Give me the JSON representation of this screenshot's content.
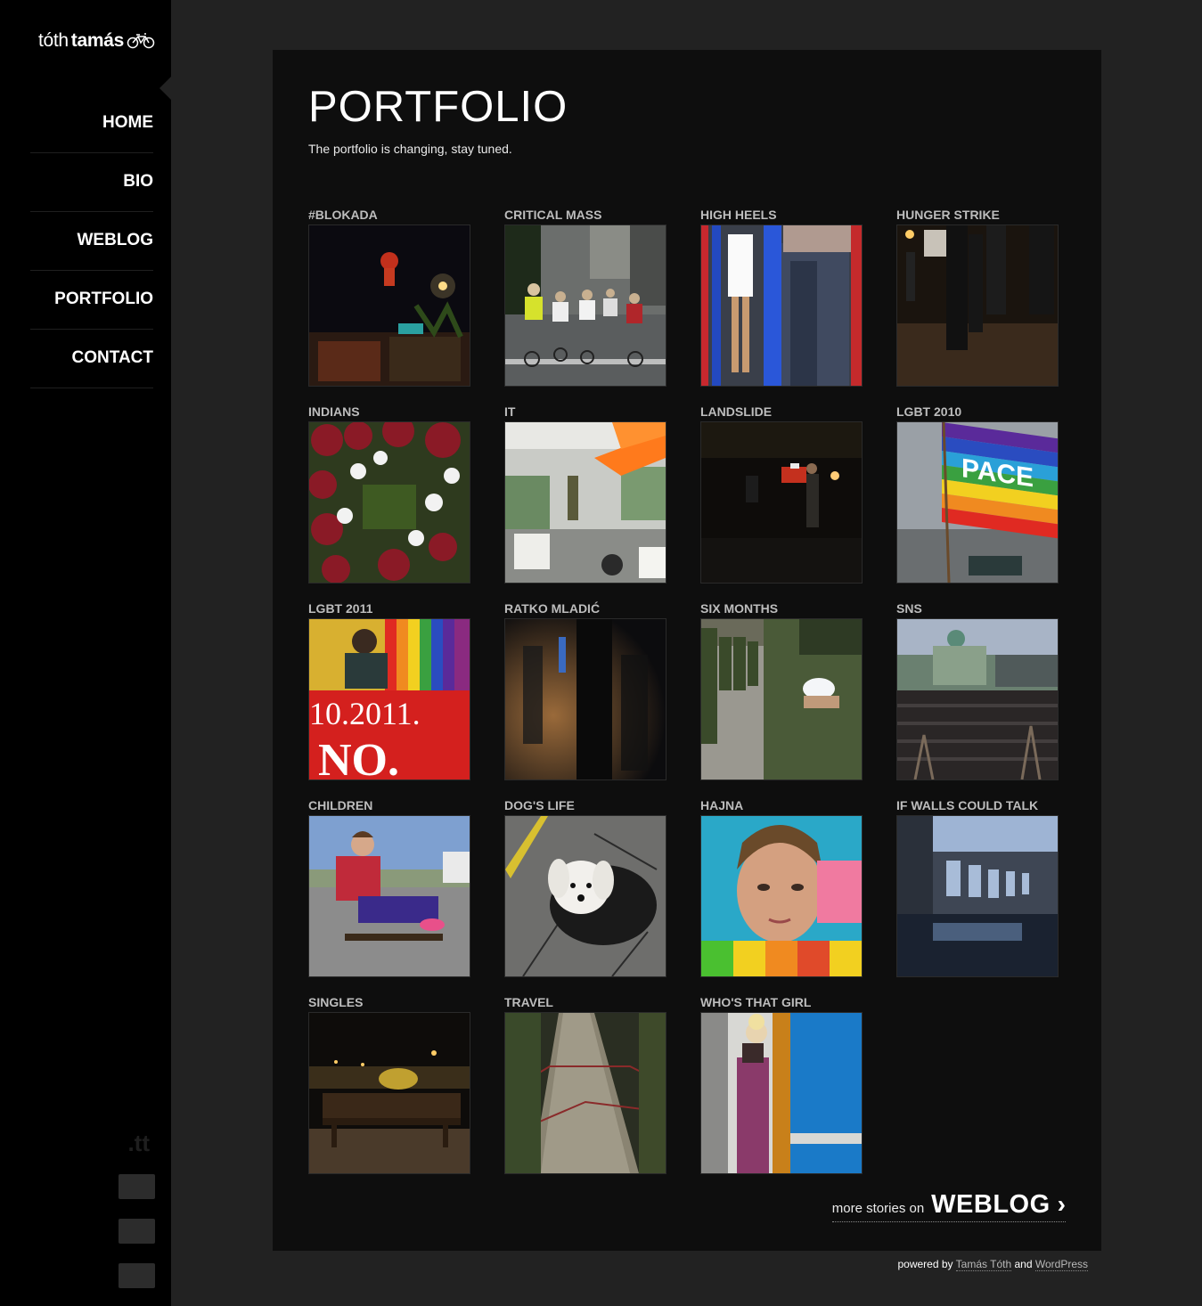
{
  "logo": {
    "light": "tóth",
    "bold": "tamás"
  },
  "nav": {
    "items": [
      {
        "label": "HOME"
      },
      {
        "label": "BIO"
      },
      {
        "label": "WEBLOG"
      },
      {
        "label": "PORTFOLIO"
      },
      {
        "label": "CONTACT"
      }
    ]
  },
  "sidebar": {
    "mark": ".tt"
  },
  "page": {
    "title": "PORTFOLIO",
    "subtitle": "The portfolio is changing, stay tuned."
  },
  "portfolio": [
    {
      "label": "#BLOKADA"
    },
    {
      "label": "CRITICAL MASS"
    },
    {
      "label": "HIGH HEELS"
    },
    {
      "label": "HUNGER STRIKE"
    },
    {
      "label": "INDIANS"
    },
    {
      "label": "IT"
    },
    {
      "label": "LANDSLIDE"
    },
    {
      "label": "LGBT 2010"
    },
    {
      "label": "LGBT 2011"
    },
    {
      "label": "RATKO MLADIĆ"
    },
    {
      "label": "SIX MONTHS"
    },
    {
      "label": "SNS"
    },
    {
      "label": "CHILDREN"
    },
    {
      "label": "DOG'S LIFE"
    },
    {
      "label": "HAJNA"
    },
    {
      "label": "IF WALLS COULD TALK"
    },
    {
      "label": "SINGLES"
    },
    {
      "label": "TRAVEL"
    },
    {
      "label": "WHO'S THAT GIRL"
    }
  ],
  "more": {
    "prefix": "more stories on",
    "big": "WEBLOG",
    "arrow": "›"
  },
  "footer": {
    "prefix": "powered by",
    "author": "Tamás Tóth",
    "and": "and",
    "platform": "WordPress"
  },
  "thumb_text": {
    "pace": "PACE",
    "lgbt2011_line1": "10.2011.",
    "lgbt2011_line2": "NO."
  }
}
